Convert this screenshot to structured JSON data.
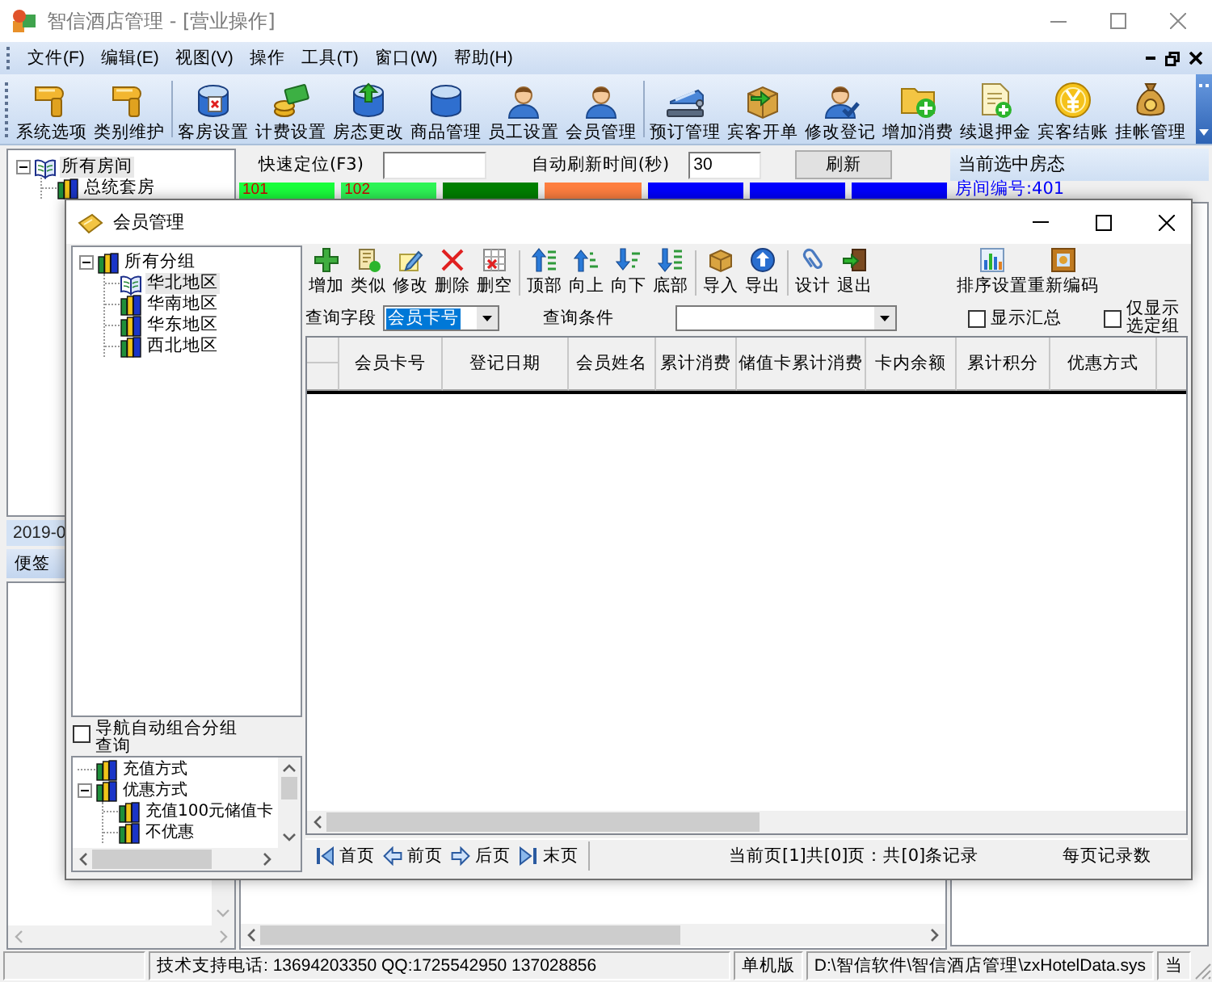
{
  "window": {
    "title": "智信酒店管理 - [营业操作]"
  },
  "menu": [
    "文件(F)",
    "编辑(E)",
    "视图(V)",
    "操作",
    "工具(T)",
    "窗口(W)",
    "帮助(H)"
  ],
  "toolbar": [
    [
      "系统选项",
      "类别维护"
    ],
    [
      "客房设置",
      "计费设置",
      "房态更改",
      "商品管理",
      "员工设置",
      "会员管理"
    ],
    [
      "预订管理",
      "宾客开单",
      "修改登记",
      "增加消费",
      "续退押金",
      "宾客结账",
      "挂帐管理"
    ]
  ],
  "room_tree": {
    "label": "所有房间",
    "selected": true,
    "expanded": true,
    "children": [
      {
        "label": "总统套房",
        "selected": false
      }
    ]
  },
  "date_bar": "2019-0",
  "notes": {
    "title": "便签"
  },
  "quick_locate": {
    "label": "快速定位(F3)"
  },
  "refresh_interval": {
    "label": "自动刷新时间(秒)",
    "value": "30"
  },
  "refresh_button": "刷新",
  "rooms": [
    {
      "label": "101",
      "color": "#19ff3c"
    },
    {
      "label": "102",
      "color": "#2ef556"
    },
    {
      "color": "#008000"
    },
    {
      "color": "#ff7f40"
    },
    {
      "color": "#0000ff"
    },
    {
      "color": "#0000ff"
    },
    {
      "color": "#0000ff"
    }
  ],
  "room_status": {
    "title": "当前选中房态",
    "room_number": "房间编号:401"
  },
  "dialog": {
    "title": "会员管理",
    "group_tree": {
      "label": "所有分组",
      "selected": false,
      "expanded": true,
      "children": [
        {
          "label": "华北地区",
          "selected": true
        },
        {
          "label": "华南地区",
          "selected": false
        },
        {
          "label": "华东地区",
          "selected": false
        },
        {
          "label": "西北地区",
          "selected": false
        }
      ]
    },
    "auto_group_query": {
      "label": "导航自动组合分组查询",
      "checked": false
    },
    "filter_tree": [
      {
        "label": "充值方式",
        "selected": false
      },
      {
        "label": "优惠方式",
        "selected": false,
        "expanded": true,
        "children": [
          {
            "label": "充值100元储值卡",
            "selected": false
          },
          {
            "label": "不优惠",
            "selected": false
          }
        ]
      }
    ],
    "toolbar": [
      [
        "增加",
        "类似",
        "修改",
        "删除",
        "删空"
      ],
      [
        "顶部",
        "向上",
        "向下",
        "底部"
      ],
      [
        "导入",
        "导出"
      ],
      [
        "设计",
        "退出"
      ]
    ],
    "sort_tools": [
      "排序设置",
      "重新编码"
    ],
    "query_field": {
      "label": "查询字段",
      "value": "会员卡号"
    },
    "query_condition": {
      "label": "查询条件"
    },
    "show_totals": {
      "label": "显示汇总",
      "checked": false
    },
    "selected_groups_only": {
      "label": "仅显示选定组",
      "checked": false
    },
    "table": {
      "columns": [
        "会员卡号",
        "登记日期",
        "会员姓名",
        "累计消费",
        "储值卡累计消费",
        "卡内余额",
        "累计积分",
        "优惠方式"
      ]
    },
    "pager": {
      "buttons": [
        "首页",
        "前页",
        "后页",
        "末页"
      ],
      "status": "当前页[1]共[0]页：共[0]条记录",
      "page_size_label": "每页记录数"
    }
  },
  "status_bar": [
    "技术支持电话: 13694203350 QQ:1725542950 137028856",
    "单机版",
    "D:\\智信软件\\智信酒店管理\\zxHotelData.sys",
    "当"
  ]
}
